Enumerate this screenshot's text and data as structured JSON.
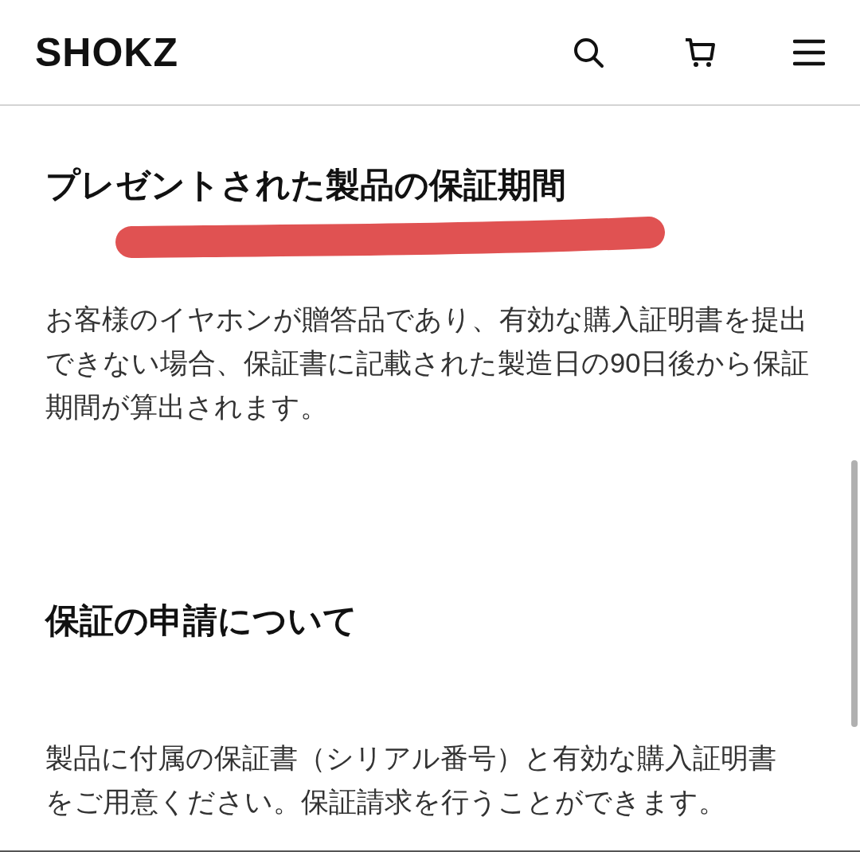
{
  "header": {
    "logo": "SHOKZ"
  },
  "sections": [
    {
      "heading": "プレゼントされた製品の保証期間",
      "highlighted": true,
      "body": "お客様のイヤホンが贈答品であり、有効な購入証明書を提出できない場合、保証書に記載された製造日の90日後から保証期間が算出されます。"
    },
    {
      "heading": "保証の申請について",
      "body": "製品に付属の保証書（シリアル番号）と有効な購入証明書をご用意ください。保証請求を行うことができます。"
    }
  ]
}
